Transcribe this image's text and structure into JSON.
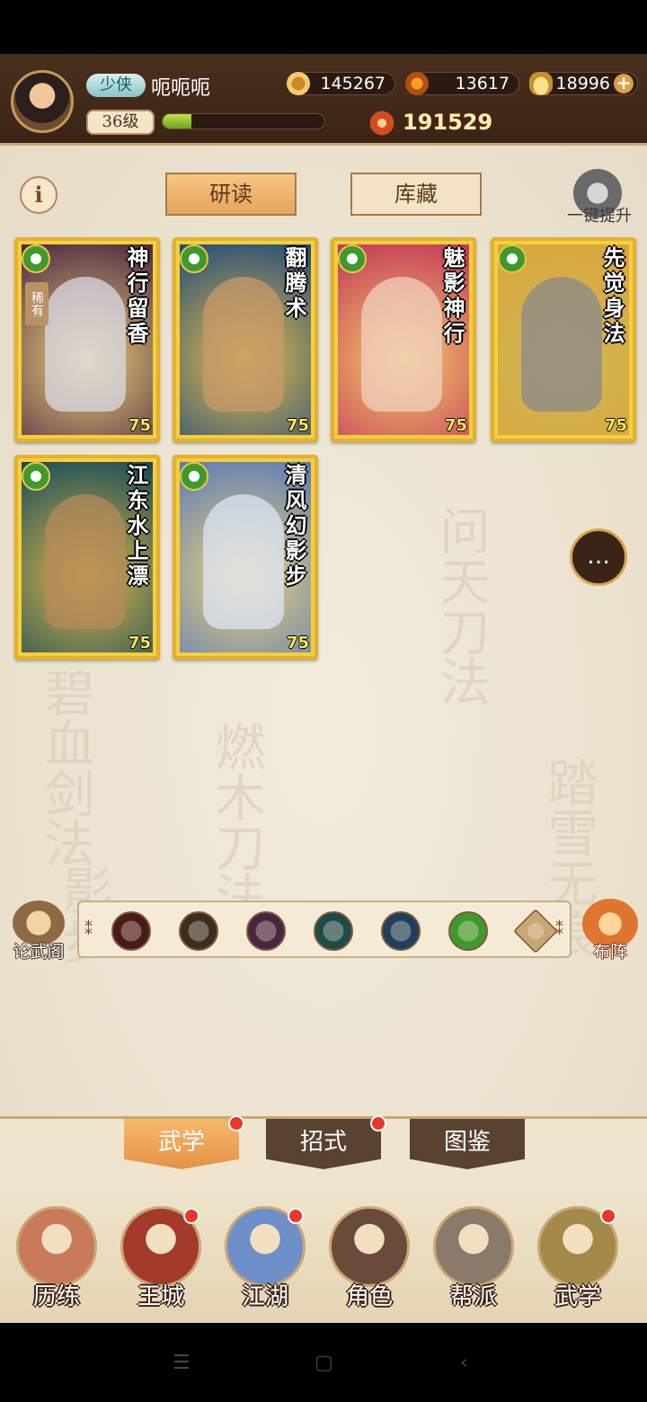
{
  "player": {
    "rank": "少侠",
    "name": "呃呃呃",
    "level": "36级",
    "exp_fraction": 0.18,
    "power": "191529"
  },
  "currencies": {
    "coins": "145267",
    "fire": "13617",
    "gold_ingot": "18996"
  },
  "tabs": {
    "study": "研读",
    "storage": "库藏"
  },
  "upgrade_label": "一键提升",
  "cards": [
    {
      "title": "神行留香",
      "level": "75",
      "rare": "稀有",
      "bg": "#4a2545",
      "fig": "#d9d9e6"
    },
    {
      "title": "翻腾术",
      "level": "75",
      "rare": "",
      "bg": "#1f4a7a",
      "fig": "#c89a6a"
    },
    {
      "title": "魅影神行",
      "level": "75",
      "rare": "",
      "bg": "#c4335a",
      "fig": "#f0d0c0"
    },
    {
      "title": "先觉身法",
      "level": "75",
      "rare": "",
      "bg": "#d9a53a",
      "fig": "#8a8a8a"
    },
    {
      "title": "江东水上漂",
      "level": "75",
      "rare": "",
      "bg": "#134a5a",
      "fig": "#b58a5a"
    },
    {
      "title": "清风幻影步",
      "level": "75",
      "rare": "",
      "bg": "#5a78b8",
      "fig": "#dce6f5"
    }
  ],
  "bg_calligraphy": [
    "踏雪无痕",
    "问天刀法",
    "燃木刀法",
    "影步",
    "碧血剑法"
  ],
  "lunwuge_label": "论武阁",
  "buzhen_label": "布阵",
  "elements": [
    "#4a1a1a",
    "#3a2e20",
    "#4a2540",
    "#1f4a4a",
    "#1f3f5a",
    "#3f9a2e",
    "#c9a774"
  ],
  "subtabs": [
    "武学",
    "招式",
    "图鉴"
  ],
  "nav": [
    {
      "label": "历练",
      "color": "#c97a5a",
      "dot": false
    },
    {
      "label": "王城",
      "color": "#a33a2a",
      "dot": true
    },
    {
      "label": "江湖",
      "color": "#6f8fc9",
      "dot": true
    },
    {
      "label": "角色",
      "color": "#6a4a3a",
      "dot": false
    },
    {
      "label": "帮派",
      "color": "#8a7a6a",
      "dot": false
    },
    {
      "label": "武学",
      "color": "#a38a4a",
      "dot": true
    }
  ],
  "chat_icon": "speech-bubble-icon",
  "colors": {
    "accent": "#e6a45c",
    "card_border": "#e2b12d",
    "notification": "#e8382b"
  }
}
